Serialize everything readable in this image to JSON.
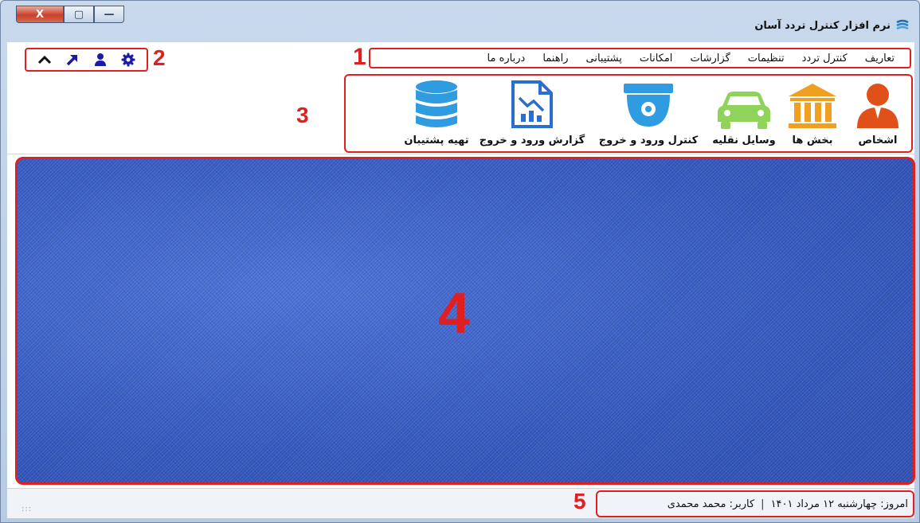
{
  "window": {
    "title": "نرم افزار کنترل تردد آسان",
    "close_label": "X",
    "max_label": "▢",
    "min_label": "—"
  },
  "menu": {
    "items": [
      {
        "label": "تعاریف"
      },
      {
        "label": "کنترل تردد"
      },
      {
        "label": "تنظیمات"
      },
      {
        "label": "گزارشات"
      },
      {
        "label": "امکانات"
      },
      {
        "label": "پشتیبانی"
      },
      {
        "label": "راهنما"
      },
      {
        "label": "درباره ما"
      }
    ]
  },
  "quick_icons": [
    {
      "icon": "gear-icon"
    },
    {
      "icon": "user-icon"
    },
    {
      "icon": "arrow-up-right-icon"
    },
    {
      "icon": "chevron-up-icon"
    }
  ],
  "ribbon": {
    "buttons": [
      {
        "label": "اشخاص",
        "icon": "person-icon"
      },
      {
        "label": "بخش ها",
        "icon": "building-icon"
      },
      {
        "label": "وسایل نقلیه",
        "icon": "car-icon"
      },
      {
        "label": "کنترل ورود و خروج",
        "icon": "camera-icon"
      },
      {
        "label": "گزارش ورود و خروج",
        "icon": "report-icon"
      },
      {
        "label": "تهیه پشتیبان",
        "icon": "database-icon"
      }
    ]
  },
  "annotations": {
    "n1": "1",
    "n2": "2",
    "n3": "3",
    "n4": "4",
    "n5": "5"
  },
  "status": {
    "date_text": "امروز: چهارشنبه ۱۲ مرداد ۱۴۰۱",
    "separator": "|",
    "user_text": "کاربر: محمد محمدی",
    "grip": ":::"
  },
  "colors": {
    "accent_red": "#e02020",
    "icon_blue": "#1a1aa6",
    "person_orange": "#e0511a",
    "building_orange": "#f0a020",
    "car_green": "#8fd35a",
    "ribbon_blue": "#2f9be0",
    "workspace_blue": "#3c62c8"
  }
}
